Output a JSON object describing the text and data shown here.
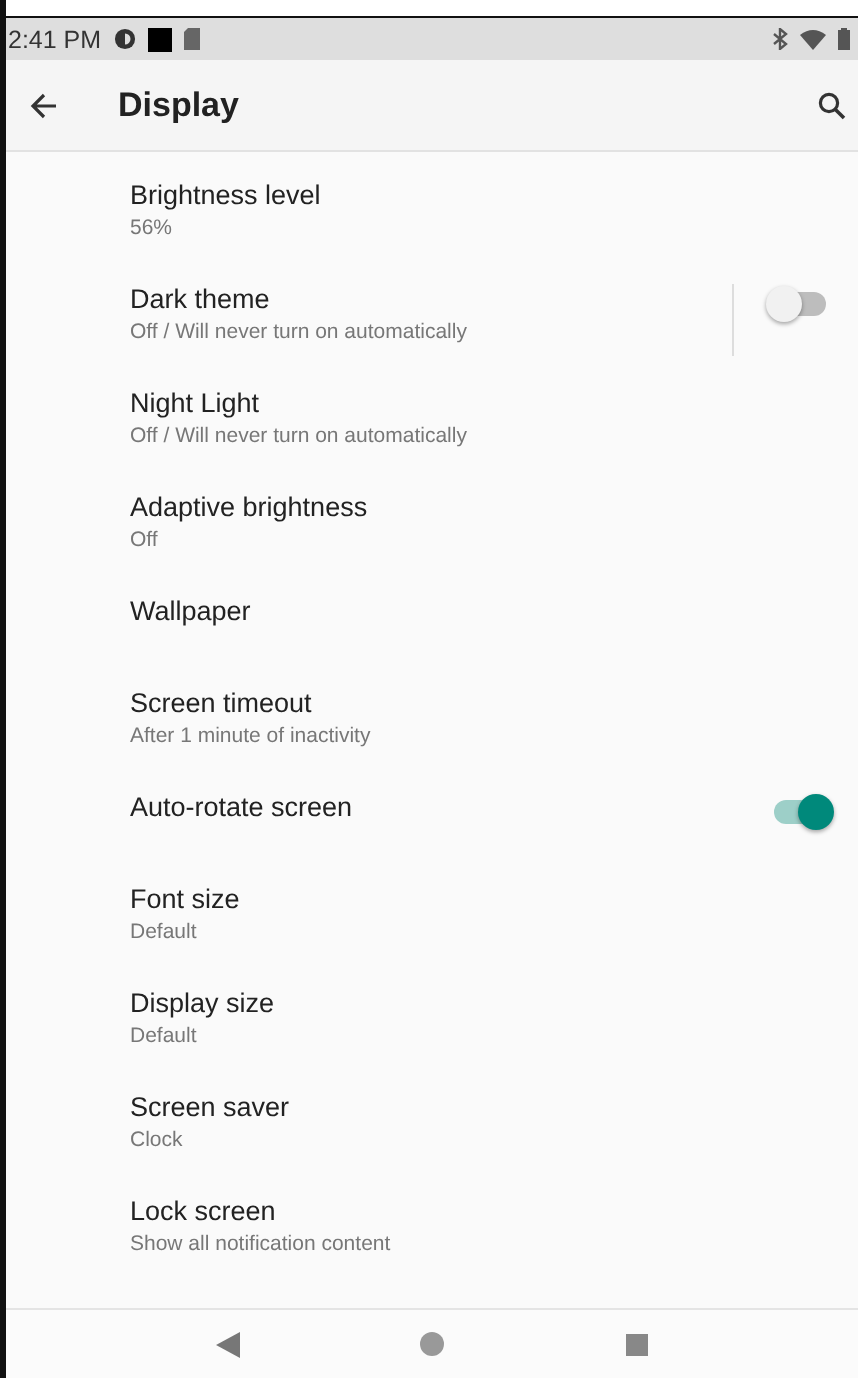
{
  "status_bar": {
    "time": "2:41 PM"
  },
  "toolbar": {
    "title": "Display"
  },
  "settings": [
    {
      "kind": "plain",
      "title": "Brightness level",
      "summary": "56%"
    },
    {
      "kind": "switch",
      "title": "Dark theme",
      "summary": "Off / Will never turn on automatically",
      "on": false,
      "divider": true
    },
    {
      "kind": "plain",
      "title": "Night Light",
      "summary": "Off / Will never turn on automatically"
    },
    {
      "kind": "plain",
      "title": "Adaptive brightness",
      "summary": "Off"
    },
    {
      "kind": "plain",
      "title": "Wallpaper"
    },
    {
      "kind": "plain",
      "title": "Screen timeout",
      "summary": "After 1 minute of inactivity"
    },
    {
      "kind": "switch",
      "title": "Auto-rotate screen",
      "on": true,
      "divider": false
    },
    {
      "kind": "plain",
      "title": "Font size",
      "summary": "Default"
    },
    {
      "kind": "plain",
      "title": "Display size",
      "summary": "Default"
    },
    {
      "kind": "plain",
      "title": "Screen saver",
      "summary": "Clock"
    },
    {
      "kind": "plain",
      "title": "Lock screen",
      "summary": "Show all notification content"
    }
  ]
}
